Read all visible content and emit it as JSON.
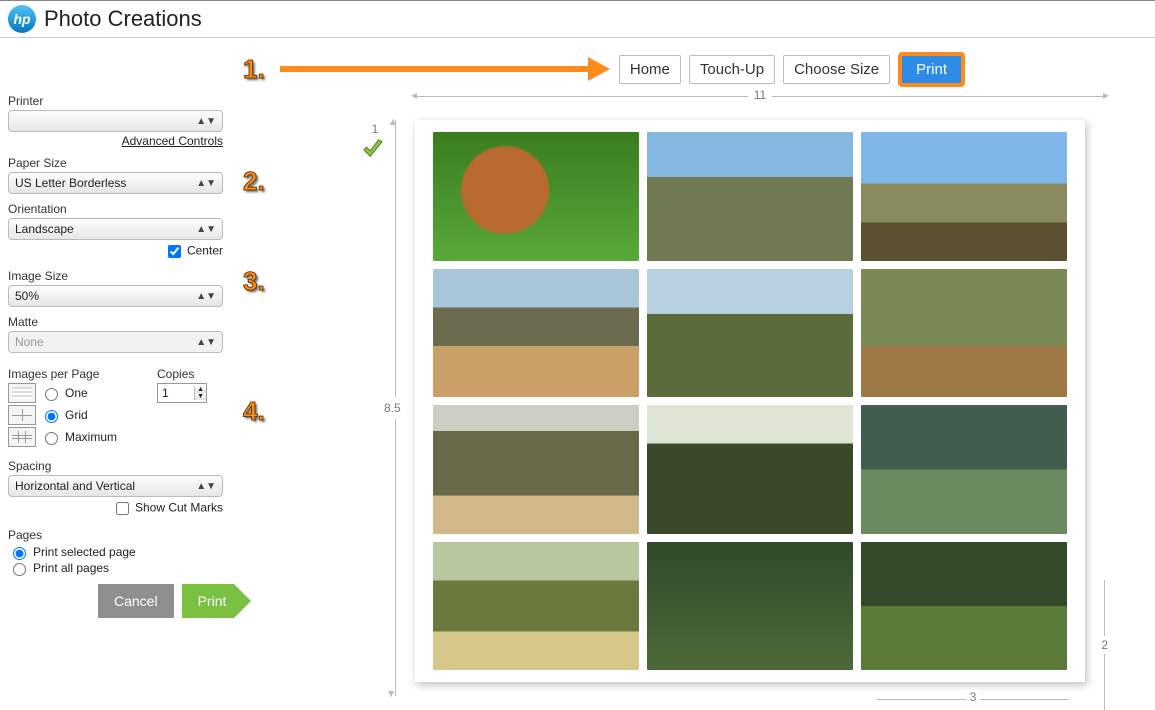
{
  "app": {
    "title": "Photo Creations",
    "logo_text": "hp"
  },
  "tabs": {
    "home": "Home",
    "touchup": "Touch-Up",
    "choosesize": "Choose Size",
    "print": "Print"
  },
  "sidebar": {
    "printer_label": "Printer",
    "printer_value": "",
    "advanced_controls": "Advanced Controls",
    "papersize_label": "Paper Size",
    "papersize_value": "US Letter Borderless",
    "orientation_label": "Orientation",
    "orientation_value": "Landscape",
    "center_label": "Center",
    "imagesize_label": "Image Size",
    "imagesize_value": "50%",
    "matte_label": "Matte",
    "matte_value": "None",
    "ipp_label": "Images per Page",
    "ipp_one": "One",
    "ipp_grid": "Grid",
    "ipp_max": "Maximum",
    "copies_label": "Copies",
    "copies_value": "1",
    "spacing_label": "Spacing",
    "spacing_value": "Horizontal and Vertical",
    "showcut_label": "Show Cut Marks",
    "pages_label": "Pages",
    "pages_selected": "Print selected page",
    "pages_all": "Print all pages",
    "cancel": "Cancel",
    "print": "Print"
  },
  "annotations": {
    "one": "1.",
    "two": "2.",
    "three": "3.",
    "four": "4."
  },
  "canvas": {
    "width_label": "11",
    "height_label": "8.5",
    "cell_w_label": "3",
    "cell_h_label": "2",
    "page_num": "1"
  }
}
